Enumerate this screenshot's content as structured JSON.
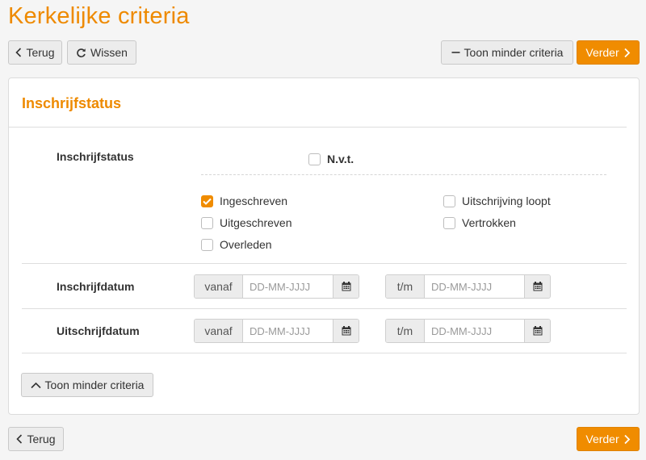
{
  "page": {
    "title": "Kerkelijke criteria"
  },
  "toolbar": {
    "back_label": "Terug",
    "clear_label": "Wissen",
    "less_criteria_label": "Toon minder criteria",
    "next_label": "Verder"
  },
  "panel": {
    "title": "Inschrijfstatus",
    "status_row": {
      "label": "Inschrijfstatus",
      "nvt_label": "N.v.t.",
      "nvt_checked": false,
      "options": [
        {
          "label": "Ingeschreven",
          "checked": true
        },
        {
          "label": "Uitgeschreven",
          "checked": false
        },
        {
          "label": "Overleden",
          "checked": false
        },
        {
          "label": "Uitschrijving loopt",
          "checked": false
        },
        {
          "label": "Vertrokken",
          "checked": false
        }
      ]
    },
    "date_rows": [
      {
        "label": "Inschrijfdatum",
        "from_addon": "vanaf",
        "to_addon": "t/m",
        "from_placeholder": "DD-MM-JJJJ",
        "to_placeholder": "DD-MM-JJJJ",
        "from_value": "",
        "to_value": ""
      },
      {
        "label": "Uitschrijfdatum",
        "from_addon": "vanaf",
        "to_addon": "t/m",
        "from_placeholder": "DD-MM-JJJJ",
        "to_placeholder": "DD-MM-JJJJ",
        "from_value": "",
        "to_value": ""
      }
    ],
    "less_criteria_label": "Toon minder criteria"
  },
  "footer": {
    "back_label": "Terug",
    "next_label": "Verder"
  },
  "colors": {
    "accent": "#f08c00",
    "title": "#ee8a00"
  },
  "icons": [
    "chevron-left-icon",
    "redo-icon",
    "minus-icon",
    "chevron-right-icon",
    "check-icon",
    "calendar-icon",
    "chevron-up-icon"
  ]
}
